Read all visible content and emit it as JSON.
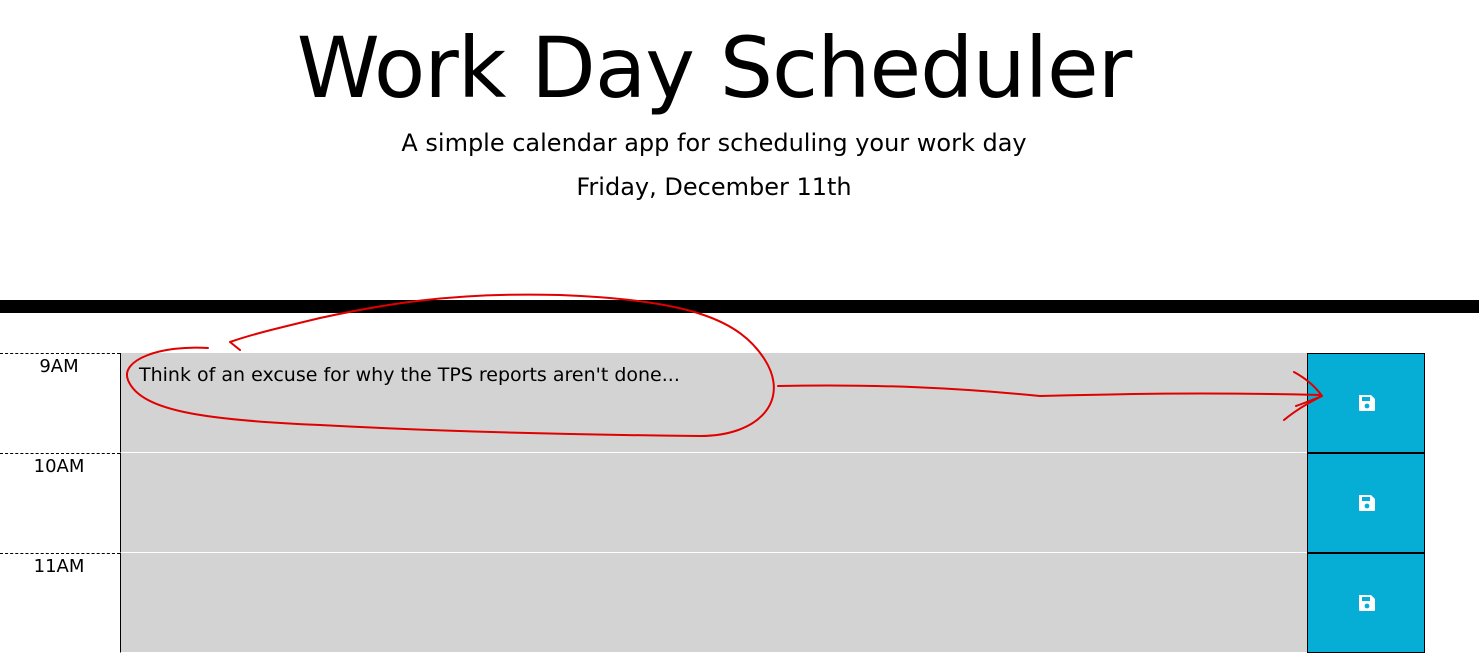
{
  "header": {
    "title": "Work Day Scheduler",
    "subtitle": "A simple calendar app for scheduling your work day",
    "current_day": "Friday, December 11th"
  },
  "colors": {
    "save_button": "#06aed5",
    "textarea_background": "#d3d3d3",
    "annotation": "#e00000"
  },
  "time_blocks": [
    {
      "hour": "9AM",
      "text": "Think of an excuse for why the TPS reports aren't done...",
      "save_icon": "floppy-disk-icon"
    },
    {
      "hour": "10AM",
      "text": "",
      "save_icon": "floppy-disk-icon"
    },
    {
      "hour": "11AM",
      "text": "",
      "save_icon": "floppy-disk-icon"
    }
  ]
}
